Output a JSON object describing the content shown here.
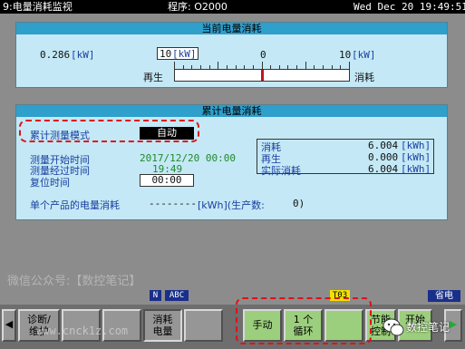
{
  "titlebar": {
    "screen": "9:电量消耗监视",
    "program_label": "程序: O2000",
    "datetime": "Wed Dec 20 19:49:51"
  },
  "current_panel": {
    "title": "当前电量消耗",
    "value": "0.286",
    "unit": "[kW]",
    "scale_left": "10",
    "scale_left_unit": "[kW]",
    "scale_zero": "0",
    "scale_right": "10",
    "scale_right_unit": "[kW]",
    "regen_label": "再生",
    "consume_label": "消耗",
    "bar_fraction": 0.5
  },
  "accum_panel": {
    "title": "累计电量消耗",
    "mode_label": "累计测量模式",
    "mode_value": "自动",
    "start_label": "测量开始时间",
    "start_value": "2017/12/20 00:00",
    "elapsed_label": "测量经过时间",
    "elapsed_value": "19:49",
    "reset_label": "复位时间",
    "reset_value": "00:00",
    "table": [
      {
        "label": "消耗",
        "value": "6.004",
        "unit": "[kWh]"
      },
      {
        "label": "再生",
        "value": "0.000",
        "unit": "[kWh]"
      },
      {
        "label": "实际消耗",
        "value": "6.004",
        "unit": "[kWh]"
      }
    ],
    "per_product_label": "单个产品的电量消耗",
    "per_product_value": "--------",
    "per_product_unit": "[kWh](生产数:",
    "per_product_count": "0)"
  },
  "watermark": "微信公众号:【数控笔记】",
  "status": {
    "n_badge": "N",
    "abc_badge": "ABC",
    "t_badge": "T03",
    "save_badge": "省电"
  },
  "softkeys": {
    "diag": "诊断/\n维护",
    "consume": "消耗\n电量",
    "manual": "手动",
    "cycle": "1 个\n循环",
    "eco": "节能\n控制",
    "switch": "开始"
  },
  "logo_text": "数控笔记",
  "site_watermark": "www.cnck1z.com",
  "colors": {
    "panel_bg": "#c4e8f5",
    "panel_header": "#2f9fcc",
    "highlight_red": "#e0101a",
    "green_text": "#1f8a2a",
    "softkey_green": "#9ccf7d"
  }
}
